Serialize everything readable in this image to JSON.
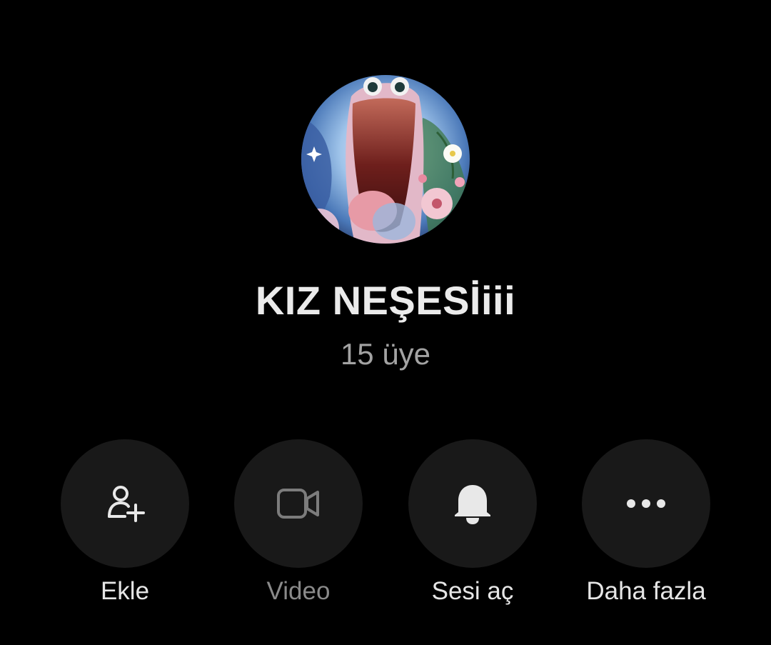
{
  "group": {
    "name": "KIZ NEŞESİiii",
    "member_count": "15 üye"
  },
  "actions": [
    {
      "label": "Ekle",
      "icon": "add-person-icon",
      "enabled": true
    },
    {
      "label": "Video",
      "icon": "video-camera-icon",
      "enabled": false
    },
    {
      "label": "Sesi aç",
      "icon": "bell-icon",
      "enabled": true
    },
    {
      "label": "Daha fazla",
      "icon": "more-dots-icon",
      "enabled": true
    }
  ],
  "colors": {
    "background": "#000000",
    "action_circle": "#191919",
    "primary_text": "#ebebeb",
    "secondary_text": "#a3a3a3",
    "disabled_text": "#8a8a8a"
  }
}
